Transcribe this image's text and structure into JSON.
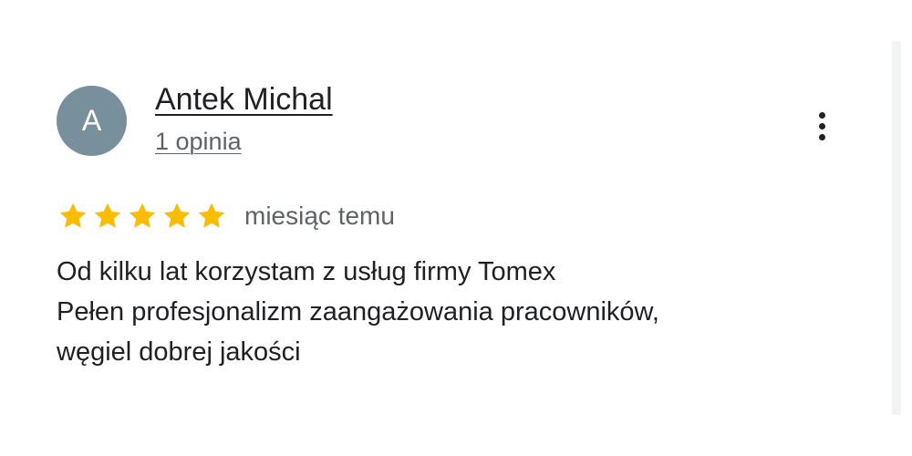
{
  "reviewer": {
    "avatar_letter": "A",
    "avatar_color": "#78909c",
    "name": "Antek Michal",
    "review_count": "1 opinia"
  },
  "review": {
    "rating": 5,
    "rating_max": 5,
    "star_color": "#fbbc04",
    "date": "miesiąc temu",
    "text_lines": [
      "Od kilku lat korzystam z usług firmy Tomex",
      "Pełen profesjonalizm zaangażowania pracowników,",
      "węgiel dobrej jakości"
    ]
  },
  "menu_icon": "more-vertical-icon"
}
